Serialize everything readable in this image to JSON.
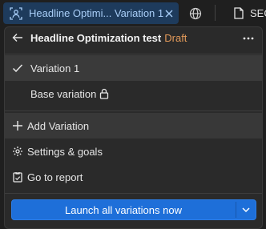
{
  "toolbar": {
    "experiment_tab": "Headline Optimi... Variation 1",
    "segment_label": "SEG"
  },
  "panel": {
    "title": "Headline Optimization test",
    "status": "Draft",
    "variations": [
      {
        "label": "Variation 1",
        "selected": true
      },
      {
        "label": "Base variation",
        "locked": true
      }
    ],
    "actions": {
      "add_variation": "Add Variation",
      "settings": "Settings & goals",
      "report": "Go to report"
    },
    "launch_button": "Launch all variations now"
  },
  "colors": {
    "accent": "#1e6fd9",
    "draft": "#e59b5a",
    "tab_bg": "#1e3b5c"
  }
}
